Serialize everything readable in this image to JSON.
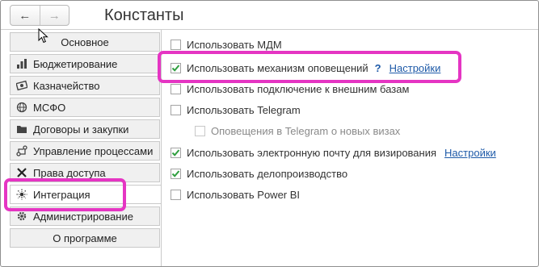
{
  "window": {
    "title": "Константы"
  },
  "nav": {
    "back_glyph": "←",
    "forward_glyph": "→"
  },
  "sidebar": {
    "items": [
      {
        "label": "Основное",
        "icon": "none"
      },
      {
        "label": "Бюджетирование",
        "icon": "chart-icon"
      },
      {
        "label": "Казначейство",
        "icon": "money-icon"
      },
      {
        "label": "МСФО",
        "icon": "globe-icon"
      },
      {
        "label": "Договоры и закупки",
        "icon": "folder-icon"
      },
      {
        "label": "Управление процессами",
        "icon": "process-icon"
      },
      {
        "label": "Права доступа",
        "icon": "tools-icon"
      },
      {
        "label": "Интеграция",
        "icon": "integration-icon"
      },
      {
        "label": "Администрирование",
        "icon": "gear-icon"
      },
      {
        "label": "О программе",
        "icon": "none"
      }
    ],
    "active_index": 7
  },
  "options": [
    {
      "label": "Использовать МДМ",
      "checked": false
    },
    {
      "label": "Использовать механизм оповещений",
      "checked": true,
      "help": "?",
      "link": "Настройки"
    },
    {
      "label": "Использовать подключение к внешним базам",
      "checked": false
    },
    {
      "label": "Использовать Telegram",
      "checked": false
    },
    {
      "label": "Оповещения в Telegram о новых визах",
      "checked": false,
      "disabled": true
    },
    {
      "label": "Использовать электронную почту для визирования",
      "checked": true,
      "link": "Настройки"
    },
    {
      "label": "Использовать делопроизводство",
      "checked": true
    },
    {
      "label": "Использовать Power BI",
      "checked": false
    }
  ],
  "colors": {
    "highlight": "#e535c3",
    "check": "#2e9e3e",
    "link": "#1e5aa8"
  }
}
